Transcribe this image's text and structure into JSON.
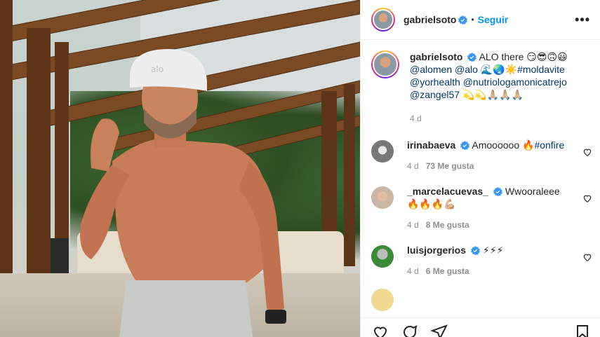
{
  "post": {
    "author": "gabrielsoto",
    "follow_label": "Seguir",
    "more_label": "•••",
    "dot": "•"
  },
  "caption": {
    "username": "gabrielsoto",
    "text_1": "ALO there 😏😎🙃😃",
    "tag_1": "@alomen",
    "tag_2": "@alo",
    "emoji_1": "🌊🌏☀️",
    "tag_3": "#moldavite",
    "tag_4": "@yorhealth",
    "tag_5": "@nutriologamonicatrejo",
    "tag_6": "@zangel57",
    "emoji_2": "💫💫🙏🏼🙏🏼🙏🏼",
    "time": "4 d"
  },
  "comments": [
    {
      "username": "irinabaeva",
      "text": "Amoooooo 🔥",
      "tag": "#onfire",
      "time": "4 d",
      "likes": "73 Me gusta"
    },
    {
      "username": "_marcelacuevas_",
      "text": "Wwooraleee",
      "text_2": "🔥🔥🔥💪🏼",
      "time": "4 d",
      "likes": "8 Me gusta"
    },
    {
      "username": "luisjorgerios",
      "text": "⚡⚡⚡",
      "time": "4 d",
      "likes": "6 Me gusta"
    }
  ],
  "colors": {
    "accent": "#0095f6",
    "verified": "#3897f0",
    "link": "#00376b",
    "muted": "#8e8e8e"
  }
}
